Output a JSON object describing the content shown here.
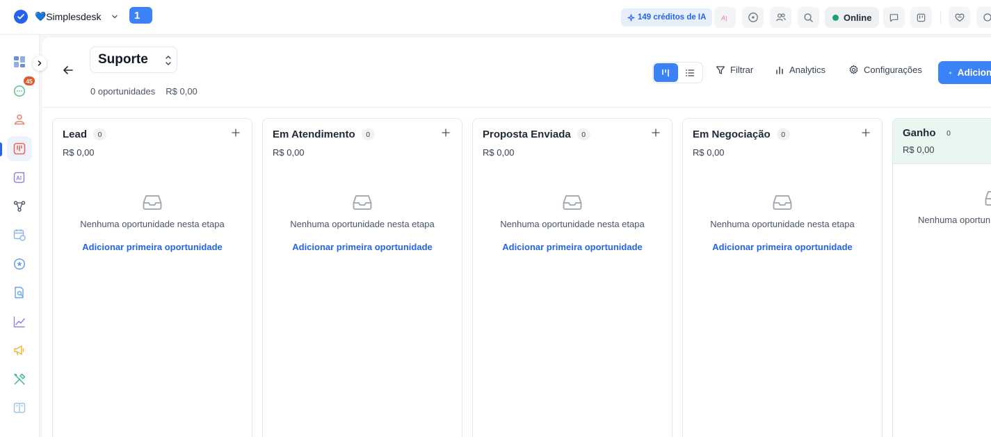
{
  "topbar": {
    "brand_name": "Simplesdesk",
    "brand_heart": "💙",
    "counter": "1",
    "credits_label": "149 créditos de IA",
    "status_label": "Online",
    "colors": {
      "accent": "#3b82f6",
      "online": "#22a06b"
    }
  },
  "sidebar": {
    "notification_count": "45",
    "items": [
      "dashboard-icon",
      "chat-icon",
      "contacts-icon",
      "kanban-icon",
      "ai-agent-icon",
      "flows-icon",
      "calendar-icon",
      "star-icon",
      "knowledge-icon",
      "reports-icon",
      "campaigns-icon",
      "tools-icon",
      "docs-icon"
    ]
  },
  "header": {
    "pipeline_name": "Suporte",
    "opportunities_count": "0 oportunidades",
    "total_value": "R$ 0,00",
    "filter_label": "Filtrar",
    "analytics_label": "Analytics",
    "settings_label": "Configurações",
    "add_label": "Adicionar"
  },
  "columns": [
    {
      "title": "Lead",
      "count": "0",
      "value": "R$ 0,00",
      "empty_text": "Nenhuma oportunidade nesta etapa",
      "add_link": "Adicionar primeira oportunidade"
    },
    {
      "title": "Em Atendimento",
      "count": "0",
      "value": "R$ 0,00",
      "empty_text": "Nenhuma oportunidade nesta etapa",
      "add_link": "Adicionar primeira oportunidade"
    },
    {
      "title": "Proposta Enviada",
      "count": "0",
      "value": "R$ 0,00",
      "empty_text": "Nenhuma oportunidade nesta etapa",
      "add_link": "Adicionar primeira oportunidade"
    },
    {
      "title": "Em Negociação",
      "count": "0",
      "value": "R$ 0,00",
      "empty_text": "Nenhuma oportunidade nesta etapa",
      "add_link": "Adicionar primeira oportunidade"
    },
    {
      "title": "Ganho",
      "count": "0",
      "value": "R$ 0,00",
      "empty_text": "Nenhuma oportunidade nesta etapa"
    }
  ]
}
